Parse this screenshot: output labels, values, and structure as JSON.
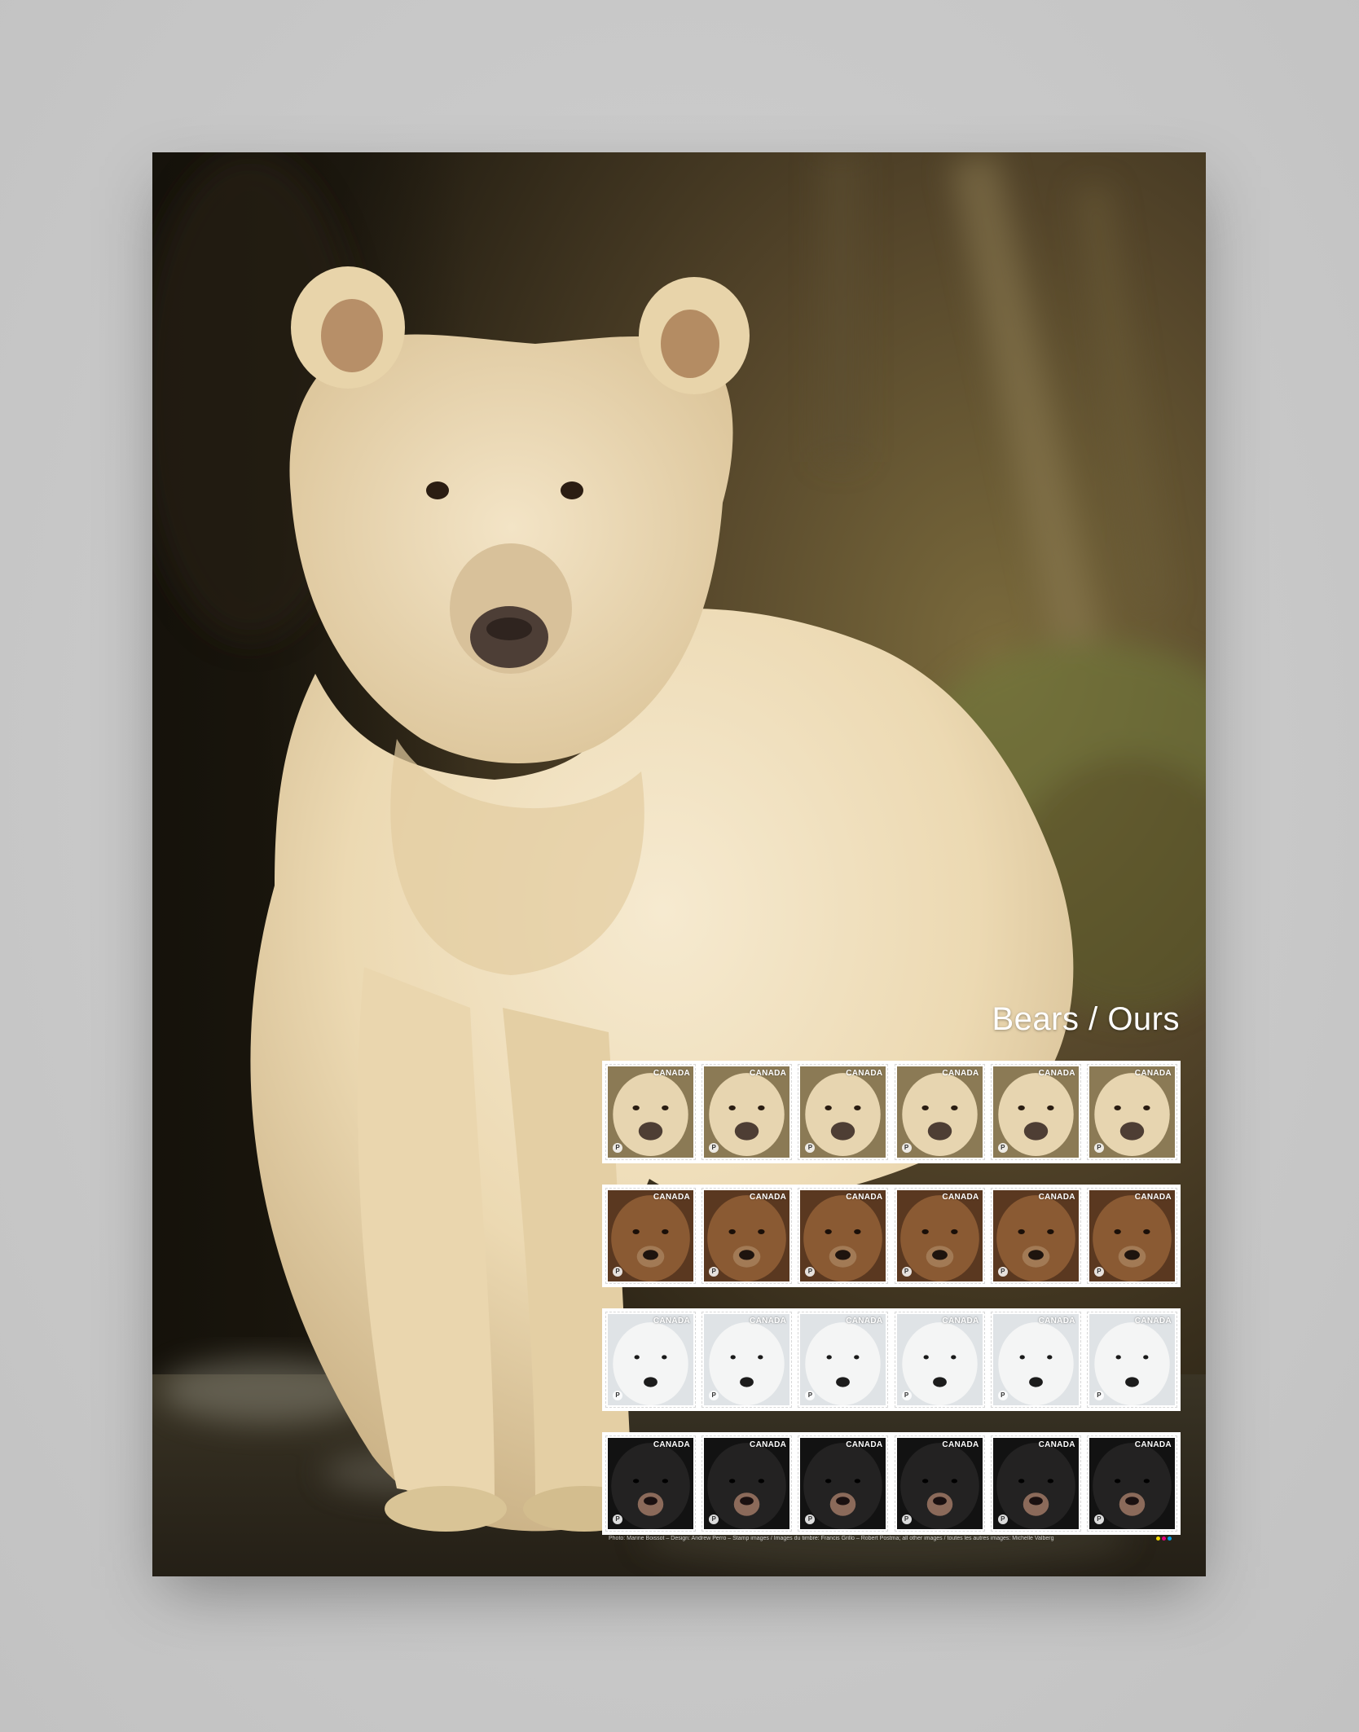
{
  "poster": {
    "title": "Bears / Ours",
    "credits": "Photo: Marine Boissot – Design: Andrew Perro – Stamp images / Images du timbre: Francis Grillo – Robert Postma; all other images / toutes les autres images: Michelle Valberg"
  },
  "stamp_sheet": {
    "rows": [
      {
        "species": "spirit-bear",
        "country": "CANADA",
        "count": 6
      },
      {
        "species": "grizzly-bear",
        "country": "CANADA",
        "count": 6
      },
      {
        "species": "polar-bear",
        "country": "CANADA",
        "count": 6
      },
      {
        "species": "black-bear",
        "country": "CANADA",
        "count": 6
      }
    ]
  },
  "colors": {
    "background": "#cbcbcb",
    "forest": "#4a3c1f",
    "bear_fur": "#efdfbd"
  },
  "icons": {
    "postage_mark": "canada-post-permanent-icon"
  }
}
